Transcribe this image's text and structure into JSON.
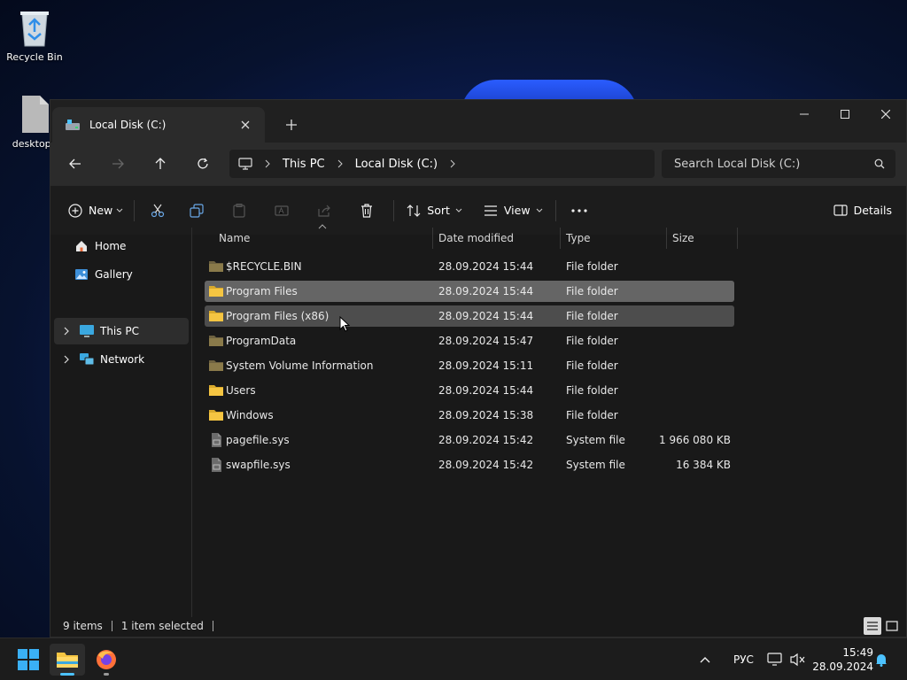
{
  "desktop": {
    "icons": [
      {
        "label": "Recycle Bin"
      },
      {
        "label": "desktop.i"
      }
    ]
  },
  "window": {
    "tab_title": "Local Disk (C:)",
    "breadcrumb": [
      "This PC",
      "Local Disk (C:)"
    ],
    "search_placeholder": "Search Local Disk (C:)",
    "toolbar": {
      "new_label": "New",
      "sort_label": "Sort",
      "view_label": "View",
      "details_label": "Details"
    },
    "sidebar": {
      "items": [
        {
          "label": "Home",
          "icon": "home-icon"
        },
        {
          "label": "Gallery",
          "icon": "gallery-icon"
        },
        {
          "label": "This PC",
          "icon": "monitor-icon",
          "selected": true
        },
        {
          "label": "Network",
          "icon": "network-icon"
        }
      ]
    },
    "columns": [
      "Name",
      "Date modified",
      "Type",
      "Size"
    ],
    "files": [
      {
        "name": "$RECYCLE.BIN",
        "date": "28.09.2024 15:44",
        "type": "File folder",
        "size": "",
        "kind": "folder-dim"
      },
      {
        "name": "Program Files",
        "date": "28.09.2024 15:44",
        "type": "File folder",
        "size": "",
        "kind": "folder",
        "state": "selected"
      },
      {
        "name": "Program Files (x86)",
        "date": "28.09.2024 15:44",
        "type": "File folder",
        "size": "",
        "kind": "folder",
        "state": "hover"
      },
      {
        "name": "ProgramData",
        "date": "28.09.2024 15:47",
        "type": "File folder",
        "size": "",
        "kind": "folder-dim"
      },
      {
        "name": "System Volume Information",
        "date": "28.09.2024 15:11",
        "type": "File folder",
        "size": "",
        "kind": "folder-dim"
      },
      {
        "name": "Users",
        "date": "28.09.2024 15:44",
        "type": "File folder",
        "size": "",
        "kind": "folder"
      },
      {
        "name": "Windows",
        "date": "28.09.2024 15:38",
        "type": "File folder",
        "size": "",
        "kind": "folder"
      },
      {
        "name": "pagefile.sys",
        "date": "28.09.2024 15:42",
        "type": "System file",
        "size": "1 966 080 KB",
        "kind": "sysfile"
      },
      {
        "name": "swapfile.sys",
        "date": "28.09.2024 15:42",
        "type": "System file",
        "size": "16 384 KB",
        "kind": "sysfile"
      }
    ],
    "status": {
      "count": "9 items",
      "selection": "1 item selected"
    }
  },
  "taskbar": {
    "lang": "РУС",
    "time": "15:49",
    "date": "28.09.2024"
  },
  "colors": {
    "accent": "#4cc2ff",
    "folder": "#f5c542",
    "folder_dim": "#8a7a4a"
  }
}
